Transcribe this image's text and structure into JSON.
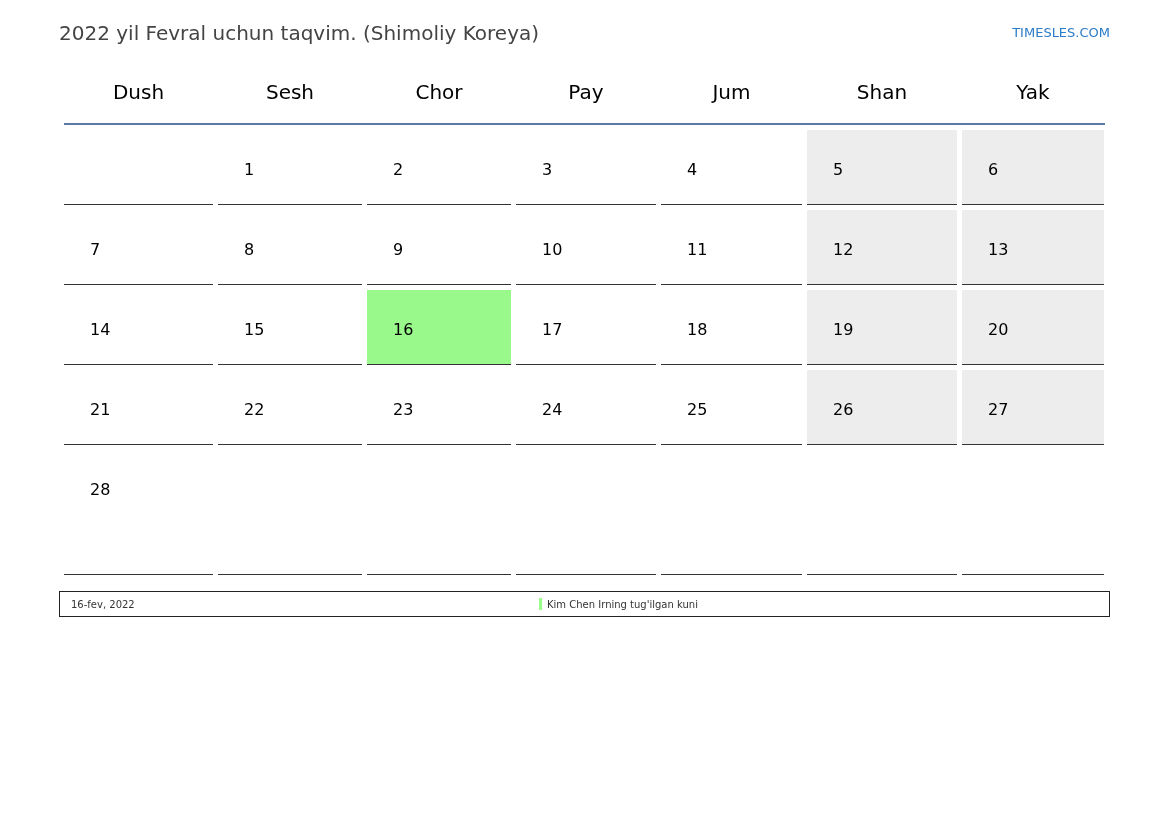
{
  "title": "2022 yil Fevral uchun taqvim. (Shimoliy Koreya)",
  "site_link": "TIMESLES.COM",
  "weekdays": [
    "Dush",
    "Sesh",
    "Chor",
    "Pay",
    "Jum",
    "Shan",
    "Yak"
  ],
  "weeks": [
    [
      {
        "shaded": false,
        "holiday": false
      },
      {
        "day": "1",
        "shaded": false,
        "holiday": false
      },
      {
        "day": "2",
        "shaded": false,
        "holiday": false
      },
      {
        "day": "3",
        "shaded": false,
        "holiday": false
      },
      {
        "day": "4",
        "shaded": false,
        "holiday": false
      },
      {
        "day": "5",
        "shaded": true,
        "holiday": false
      },
      {
        "day": "6",
        "shaded": true,
        "holiday": false
      }
    ],
    [
      {
        "day": "7",
        "shaded": false,
        "holiday": false
      },
      {
        "day": "8",
        "shaded": false,
        "holiday": false
      },
      {
        "day": "9",
        "shaded": false,
        "holiday": false
      },
      {
        "day": "10",
        "shaded": false,
        "holiday": false
      },
      {
        "day": "11",
        "shaded": false,
        "holiday": false
      },
      {
        "day": "12",
        "shaded": true,
        "holiday": false
      },
      {
        "day": "13",
        "shaded": true,
        "holiday": false
      }
    ],
    [
      {
        "day": "14",
        "shaded": false,
        "holiday": false
      },
      {
        "day": "15",
        "shaded": false,
        "holiday": false
      },
      {
        "day": "16",
        "holiday": true
      },
      {
        "day": "17",
        "shaded": false,
        "holiday": false
      },
      {
        "day": "18",
        "shaded": false,
        "holiday": false
      },
      {
        "day": "19",
        "shaded": true,
        "holiday": false
      },
      {
        "day": "20",
        "shaded": true,
        "holiday": false
      }
    ],
    [
      {
        "day": "21",
        "shaded": false,
        "holiday": false
      },
      {
        "day": "22",
        "shaded": false,
        "holiday": false
      },
      {
        "day": "23",
        "shaded": false,
        "holiday": false
      },
      {
        "day": "24",
        "shaded": false,
        "holiday": false
      },
      {
        "day": "25",
        "shaded": false,
        "holiday": false
      },
      {
        "day": "26",
        "shaded": true,
        "holiday": false
      },
      {
        "day": "27",
        "shaded": true,
        "holiday": false
      }
    ],
    [
      {
        "day": "28",
        "shaded": false,
        "holiday": false
      },
      {
        "shaded": false,
        "holiday": false
      },
      {
        "shaded": false,
        "holiday": false
      },
      {
        "shaded": false,
        "holiday": false
      },
      {
        "shaded": false,
        "holiday": false
      },
      {
        "shaded": false,
        "holiday": false
      },
      {
        "shaded": false,
        "holiday": false
      }
    ]
  ],
  "holidays": [
    {
      "date": "16-fev, 2022",
      "name": "Kim Chen Irning tug'ilgan kuni",
      "color": "#99ff88"
    }
  ]
}
